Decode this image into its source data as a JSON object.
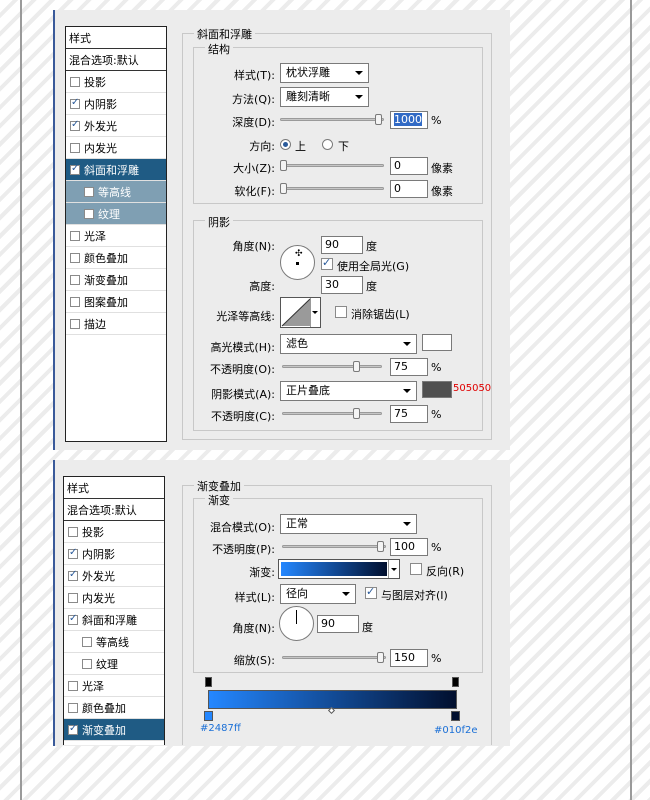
{
  "panel1": {
    "styles_header": "样式",
    "blend_default": "混合选项:默认",
    "items": [
      {
        "label": "投影",
        "checked": false
      },
      {
        "label": "内阴影",
        "checked": true
      },
      {
        "label": "外发光",
        "checked": true
      },
      {
        "label": "内发光",
        "checked": false
      },
      {
        "label": "斜面和浮雕",
        "checked": true
      },
      {
        "label": "等高线",
        "checked": false
      },
      {
        "label": "纹理",
        "checked": false
      },
      {
        "label": "光泽",
        "checked": false
      },
      {
        "label": "颜色叠加",
        "checked": false
      },
      {
        "label": "渐变叠加",
        "checked": false
      },
      {
        "label": "图案叠加",
        "checked": false
      },
      {
        "label": "描边",
        "checked": false
      }
    ],
    "section_title": "斜面和浮雕",
    "structure": {
      "title": "结构",
      "style_label": "样式(T):",
      "style_value": "枕状浮雕",
      "technique_label": "方法(Q):",
      "technique_value": "雕刻清晰",
      "depth_label": "深度(D):",
      "depth_value": "1000",
      "depth_unit": "%",
      "direction_label": "方向:",
      "direction_up": "上",
      "direction_down": "下",
      "size_label": "大小(Z):",
      "size_value": "0",
      "size_unit": "像素",
      "soften_label": "软化(F):",
      "soften_value": "0",
      "soften_unit": "像素"
    },
    "shading": {
      "title": "阴影",
      "angle_label": "角度(N):",
      "angle_value": "90",
      "angle_unit": "度",
      "global_light_label": "使用全局光(G)",
      "altitude_label": "高度:",
      "altitude_value": "30",
      "altitude_unit": "度",
      "gloss_label": "光泽等高线:",
      "antialias_label": "消除锯齿(L)",
      "highlight_mode_label": "高光模式(H):",
      "highlight_mode_value": "滤色",
      "highlight_color": "#ffffff",
      "highlight_opacity_label": "不透明度(O):",
      "highlight_opacity_value": "75",
      "highlight_opacity_unit": "%",
      "shadow_mode_label": "阴影模式(A):",
      "shadow_mode_value": "正片叠底",
      "shadow_color": "#505050",
      "shadow_color_note": "505050",
      "shadow_opacity_label": "不透明度(C):",
      "shadow_opacity_value": "75",
      "shadow_opacity_unit": "%"
    }
  },
  "panel2": {
    "styles_header": "样式",
    "blend_default": "混合选项:默认",
    "items": [
      {
        "label": "投影",
        "checked": false
      },
      {
        "label": "内阴影",
        "checked": true
      },
      {
        "label": "外发光",
        "checked": true
      },
      {
        "label": "内发光",
        "checked": false
      },
      {
        "label": "斜面和浮雕",
        "checked": true
      },
      {
        "label": "等高线",
        "checked": false
      },
      {
        "label": "纹理",
        "checked": false
      },
      {
        "label": "光泽",
        "checked": false
      },
      {
        "label": "颜色叠加",
        "checked": false
      },
      {
        "label": "渐变叠加",
        "checked": true
      }
    ],
    "section_title": "渐变叠加",
    "gradient": {
      "title": "渐变",
      "blend_mode_label": "混合模式(O):",
      "blend_mode_value": "正常",
      "opacity_label": "不透明度(P):",
      "opacity_value": "100",
      "opacity_unit": "%",
      "gradient_label": "渐变:",
      "reverse_label": "反向(R)",
      "style_label": "样式(L):",
      "style_value": "径向",
      "align_label": "与图层对齐(I)",
      "angle_label": "角度(N):",
      "angle_value": "90",
      "angle_unit": "度",
      "scale_label": "缩放(S):",
      "scale_value": "150",
      "scale_unit": "%",
      "color_start": "#2487ff",
      "color_end": "#010f2e",
      "start_label": "#2487ff",
      "end_label": "#010f2e"
    }
  }
}
